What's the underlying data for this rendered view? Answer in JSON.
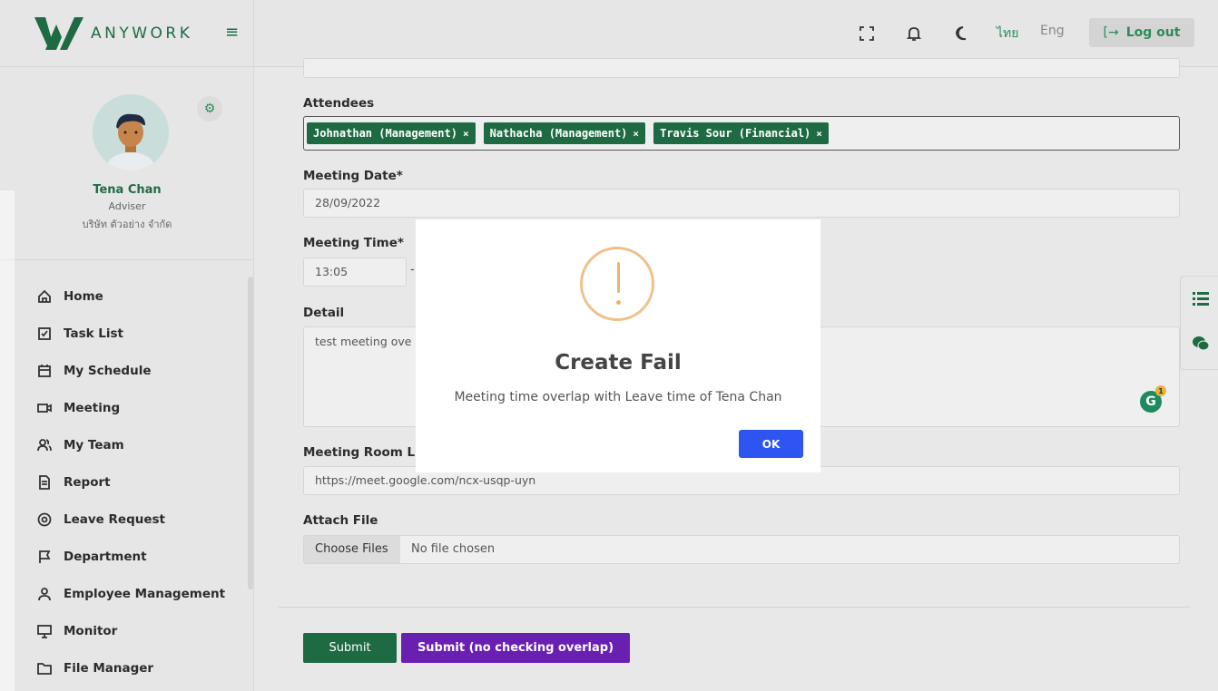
{
  "brand": {
    "name": "ANYWORK"
  },
  "profile": {
    "name": "Tena Chan",
    "role": "Adviser",
    "company": "บริษัท ตัวอย่าง จำกัด"
  },
  "nav": {
    "items": [
      {
        "label": "Home",
        "icon": "home-icon"
      },
      {
        "label": "Task List",
        "icon": "checklist-icon"
      },
      {
        "label": "My Schedule",
        "icon": "calendar-icon"
      },
      {
        "label": "Meeting",
        "icon": "video-icon"
      },
      {
        "label": "My Team",
        "icon": "team-icon"
      },
      {
        "label": "Report",
        "icon": "document-icon"
      },
      {
        "label": "Leave Request",
        "icon": "leave-icon"
      },
      {
        "label": "Department",
        "icon": "flag-icon"
      },
      {
        "label": "Employee Management",
        "icon": "user-icon"
      },
      {
        "label": "Monitor",
        "icon": "monitor-icon"
      },
      {
        "label": "File Manager",
        "icon": "folder-icon"
      }
    ]
  },
  "topbar": {
    "lang_th": "ไทย",
    "lang_en": "Eng",
    "logout": "Log out"
  },
  "form": {
    "attendees_label": "Attendees",
    "attendees": [
      "Johnathan (Management)",
      "Nathacha (Management)",
      "Travis Sour (Financial)"
    ],
    "date_label": "Meeting Date*",
    "date_value": "28/09/2022",
    "time_label": "Meeting Time*",
    "time_start": "13:05",
    "time_sep": "-",
    "detail_label": "Detail",
    "detail_value": "test meeting ove",
    "room_label": "Meeting Room Li",
    "room_value": "https://meet.google.com/ncx-usqp-uyn",
    "attach_label": "Attach File",
    "choose_files": "Choose Files",
    "no_file": "No file chosen",
    "submit": "Submit",
    "submit_nocheck": "Submit (no checking overlap)",
    "grammarly_count": "1"
  },
  "modal": {
    "title": "Create Fail",
    "message": "Meeting time overlap with Leave time of Tena Chan",
    "ok": "OK"
  },
  "colors": {
    "brand_green": "#1e6b43",
    "purple": "#6a1fb3",
    "ok_blue": "#2e55f2",
    "warning": "#f0c08a"
  }
}
